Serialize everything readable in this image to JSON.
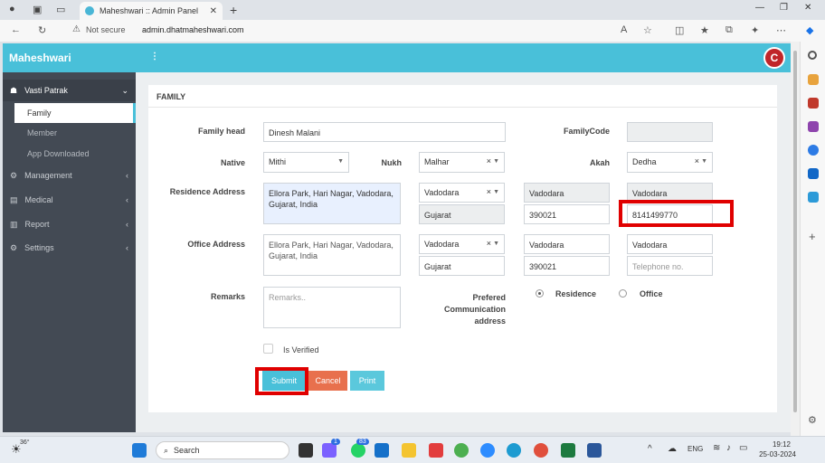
{
  "browser": {
    "tab_title": "Maheshwari :: Admin Panel",
    "not_secure": "Not secure",
    "url": "admin.dhatmaheshwari.com"
  },
  "app": {
    "brand": "Maheshwari",
    "menu_dots": "⋮",
    "logo_letter": "C"
  },
  "sidebar": {
    "items": [
      {
        "label": "Vasti Patrak",
        "icon": "sitemap-icon"
      },
      {
        "label": "Management",
        "icon": "gear-icon"
      },
      {
        "label": "Medical",
        "icon": "briefcase-icon"
      },
      {
        "label": "Report",
        "icon": "chart-icon"
      },
      {
        "label": "Settings",
        "icon": "gear-icon"
      }
    ],
    "subitems": [
      {
        "label": "Family"
      },
      {
        "label": "Member"
      },
      {
        "label": "App Downloaded"
      }
    ]
  },
  "form": {
    "title": "FAMILY",
    "family_head_label": "Family head",
    "family_head_value": "Dinesh Malani",
    "family_code_label": "FamilyCode",
    "family_code_value": "",
    "native_label": "Native",
    "native_value": "Mithi",
    "nukh_label": "Nukh",
    "nukh_value": "Malhar",
    "akah_label": "Akah",
    "akah_value": "Dedha",
    "residence_label": "Residence Address",
    "residence_address": "Ellora Park, Hari Nagar, Vadodara, Gujarat, India",
    "residence_city_select": "Vadodara",
    "residence_state": "Gujarat",
    "residence_district": "Vadodara",
    "residence_pincode": "390021",
    "residence_taluka": "Vadodara",
    "residence_phone": "8141499770",
    "office_label": "Office Address",
    "office_address": "Ellora Park, Hari Nagar, Vadodara, Gujarat, India",
    "office_city_select": "Vadodara",
    "office_state": "Gujarat",
    "office_district": "Vadodara",
    "office_pincode": "390021",
    "office_taluka": "Vadodara",
    "office_phone_placeholder": "Telephone no.",
    "remarks_label": "Remarks",
    "remarks_placeholder": "Remarks..",
    "pref_label_1": "Prefered",
    "pref_label_2": "Communication",
    "pref_label_3": "address",
    "opt_residence": "Residence",
    "opt_office": "Office",
    "verified_label": "Is Verified",
    "submit": "Submit",
    "cancel": "Cancel",
    "print": "Print"
  },
  "taskbar": {
    "temp": "36°",
    "search": "Search",
    "lang": "ENG",
    "time": "19:12",
    "date": "25-03-2024",
    "badge_1": "1",
    "badge_2": "83"
  },
  "colors": {
    "header": "#49c0d9",
    "sidebar": "#434a54",
    "submit": "#49c0d9",
    "cancel": "#e8704d",
    "print": "#5bc8dc",
    "highlight": "#e00000"
  }
}
